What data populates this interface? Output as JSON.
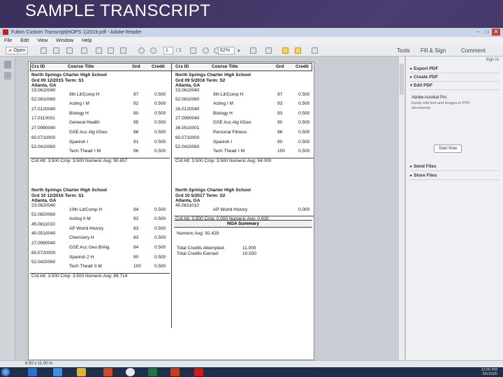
{
  "slide": {
    "title": "SAMPLE TRANSCRIPT"
  },
  "window": {
    "title": "Fulton Custom Transcript(HOPS 1)2019.pdf - Adobe Reader",
    "menu": [
      "File",
      "Edit",
      "View",
      "Window",
      "Help"
    ],
    "toolbar": {
      "open": "Open",
      "page_current": "1",
      "page_total": "/ 1",
      "zoom": "62%",
      "tools": "Tools",
      "fill_sign": "Fill & Sign",
      "comment": "Comment"
    }
  },
  "panel": {
    "sign_in": "Sign In",
    "export_pdf": "Export PDF",
    "create_pdf": "Create PDF",
    "edit_pdf": "Edit PDF",
    "edit_title": "Adobe Acrobat Pro",
    "edit_desc": "Easily edit text and images in PDF documents.",
    "start_now": "Start Now",
    "send_files": "Send Files",
    "store_files": "Store Files"
  },
  "status": {
    "page_size": "8.50 x 11.00 in"
  },
  "taskbar": {
    "time": "12:00 PM",
    "date": "5/5/2020"
  },
  "transcript": {
    "headers": [
      "Crs ID",
      "Course Title",
      "Grd",
      "Credit"
    ],
    "blocks": [
      {
        "school": "North Springs Charter High School",
        "meta": "Grd  09     12/2015     Term: S1",
        "city": "Atlanta, GA",
        "rows": [
          {
            "id": "23.0610040",
            "title": "9th Lit/Comp H",
            "grd": "97",
            "cr": "0.500"
          },
          {
            "id": "52.0810060",
            "title": "Acting I M",
            "grd": "92",
            "cr": "0.500"
          },
          {
            "id": "27.0120040",
            "title": "Biology H",
            "grd": "80",
            "cr": "0.500"
          },
          {
            "id": "17.0110001",
            "title": "General Health",
            "grd": "95",
            "cr": "0.500"
          },
          {
            "id": "27.0990040",
            "title": "GSE Acc Alg I/Geo",
            "grd": "86",
            "cr": "0.500"
          },
          {
            "id": "60.0710000",
            "title": "Spanish I",
            "grd": "91",
            "cr": "0.500"
          },
          {
            "id": "52.0410060",
            "title": "Tech Theatr I M",
            "grd": "96",
            "cr": "0.500"
          }
        ],
        "summary": "Crd Att: 3.500   Cmp: 3.500   Numeric Avg:  90.857"
      },
      {
        "school": "North Springs Charter High School",
        "meta": "Grd  10     12/2016     Term: S1",
        "city": "Atlanta, GA",
        "rows": [
          {
            "id": "23.0620040",
            "title": "10th Lit/Comp H",
            "grd": "94",
            "cr": "0.500"
          },
          {
            "id": "52.0820060",
            "title": "Acting II M",
            "grd": "92",
            "cr": "0.500"
          },
          {
            "id": "45.0811010",
            "title": "AP World History",
            "grd": "83",
            "cr": "0.500"
          },
          {
            "id": "40.0510040",
            "title": "Chemistry H",
            "grd": "83",
            "cr": "0.500"
          },
          {
            "id": "27.0990040",
            "title": "GSE Acc Geo B/Alg",
            "grd": "84",
            "cr": "0.500"
          },
          {
            "id": "60.0720000",
            "title": "Spanish 2 H",
            "grd": "90",
            "cr": "0.500"
          },
          {
            "id": "52.0420060",
            "title": "Tech Theatr II M",
            "grd": "100",
            "cr": "0.500"
          }
        ],
        "summary": "Crd Att: 3.500   Cmp: 3.500   Numeric Avg:  89.714"
      },
      {
        "school": "North Springs Charter High School",
        "meta": "Grd  09     5/2016     Term: S2",
        "city": "Atlanta, GA",
        "rows": [
          {
            "id": "23.0610040",
            "title": "9th Lit/Comp H",
            "grd": "97",
            "cr": "0.500"
          },
          {
            "id": "52.0810060",
            "title": "Acting I M",
            "grd": "93",
            "cr": "0.500"
          },
          {
            "id": "26.0120040",
            "title": "Biology H",
            "grd": "93",
            "cr": "0.500"
          },
          {
            "id": "27.0990040",
            "title": "GSE Acc Alg I/Geo",
            "grd": "90",
            "cr": "0.500"
          },
          {
            "id": "36.0510001",
            "title": "Personal Fitness",
            "grd": "96",
            "cr": "0.500"
          },
          {
            "id": "60.0710000",
            "title": "Spanish I",
            "grd": "90",
            "cr": "0.500"
          },
          {
            "id": "52.0410060",
            "title": "Tech Theatr I M",
            "grd": "100",
            "cr": "0.500"
          }
        ],
        "summary": "Crd Att: 3.500   Cmp: 3.500   Numeric Avg:  94.000"
      },
      {
        "school": "North Springs Charter High School",
        "meta": "Grd  10     5/2017     Term: S2",
        "city": "Atlanta, GA",
        "rows": [
          {
            "id": "45.0811010",
            "title": "AP World History",
            "grd": "",
            "cr": "0.000"
          }
        ],
        "summary": "Crd Att: 0.500   Cmp: 0.000   Numeric Avg:     0.000"
      }
    ],
    "nga": {
      "title": "NGA Summary",
      "numeric_avg": "Numeric Avg: 92.429",
      "attempted_label": "Total Credits Attempted:",
      "attempted_val": "11.000",
      "earned_label": "Total Credits Earned:",
      "earned_val": "10.500"
    }
  }
}
